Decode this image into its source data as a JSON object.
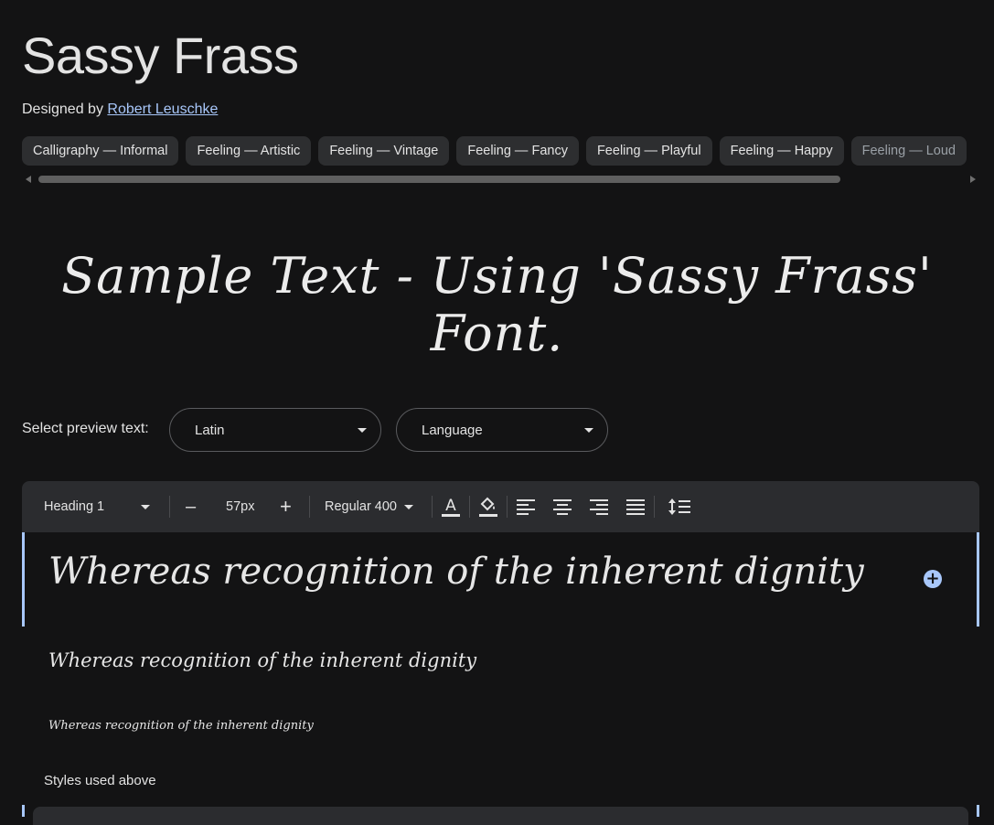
{
  "font": {
    "name": "Sassy Frass",
    "designed_by_label": "Designed by",
    "designer": "Robert Leuschke"
  },
  "tags": [
    "Calligraphy — Informal",
    "Feeling — Artistic",
    "Feeling — Vintage",
    "Feeling — Fancy",
    "Feeling — Playful",
    "Feeling — Happy",
    "Feeling — Loud"
  ],
  "sample_text": "Sample Text - Using 'Sassy Frass' Font.",
  "preview_controls": {
    "label": "Select preview text:",
    "script_select": "Latin",
    "language_select": "Language"
  },
  "toolbar": {
    "style": "Heading 1",
    "decrease": "–",
    "size": "57px",
    "increase": "+",
    "weight": "Regular 400"
  },
  "previews": [
    "Whereas recognition of the inherent dignity",
    "Whereas recognition of the inherent dignity",
    "Whereas recognition of the inherent dignity"
  ],
  "styles_used_label": "Styles used above",
  "colors": {
    "background": "#131314",
    "surface": "#2b2c2f",
    "accent": "#a8c7fa",
    "text": "#e3e3e3"
  }
}
